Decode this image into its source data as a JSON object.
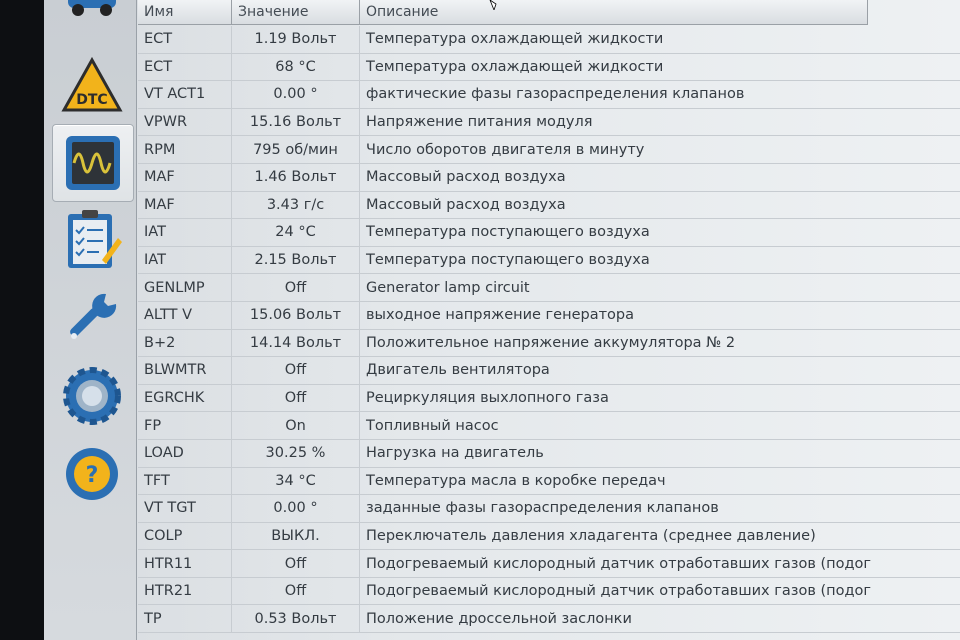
{
  "header": {
    "name": "Имя",
    "value": "Значение",
    "description": "Описание"
  },
  "sidebar": {
    "items": [
      {
        "name": "car-icon",
        "active": false
      },
      {
        "name": "dtc-icon",
        "label": "DTC",
        "active": false
      },
      {
        "name": "oscilloscope-icon",
        "active": true
      },
      {
        "name": "checklist-icon",
        "active": false
      },
      {
        "name": "wrench-icon",
        "active": false
      },
      {
        "name": "settings-gear-icon",
        "active": false
      },
      {
        "name": "steering-help-icon",
        "label": "?",
        "active": false
      }
    ]
  },
  "rows": [
    {
      "name": "ECT",
      "value": "1.19 Вольт",
      "desc": "Температура охлаждающей жидкости"
    },
    {
      "name": "ECT",
      "value": "68 °C",
      "desc": "Температура охлаждающей жидкости"
    },
    {
      "name": "VT ACT1",
      "value": "0.00 °",
      "desc": "фактические фазы газораспределения клапанов"
    },
    {
      "name": "VPWR",
      "value": "15.16 Вольт",
      "desc": "Напряжение питания модуля"
    },
    {
      "name": "RPM",
      "value": "795 об/мин",
      "desc": "Число оборотов двигателя в минуту"
    },
    {
      "name": "MAF",
      "value": "1.46 Вольт",
      "desc": "Массовый расход воздуха"
    },
    {
      "name": "MAF",
      "value": "3.43 г/с",
      "desc": "Массовый расход воздуха"
    },
    {
      "name": "IAT",
      "value": "24 °C",
      "desc": "Температура поступающего воздуха"
    },
    {
      "name": "IAT",
      "value": "2.15 Вольт",
      "desc": "Температура поступающего воздуха"
    },
    {
      "name": "GENLMP",
      "value": "Off",
      "desc": "Generator lamp circuit"
    },
    {
      "name": "ALTT V",
      "value": "15.06 Вольт",
      "desc": "выходное напряжение генератора"
    },
    {
      "name": "B+2",
      "value": "14.14 Вольт",
      "desc": "Положительное напряжение аккумулятора № 2"
    },
    {
      "name": "BLWMTR",
      "value": "Off",
      "desc": "Двигатель вентилятора"
    },
    {
      "name": "EGRCHK",
      "value": "Off",
      "desc": "Рециркуляция выхлопного газа"
    },
    {
      "name": "FP",
      "value": "On",
      "desc": "Топливный насос"
    },
    {
      "name": "LOAD",
      "value": "30.25 %",
      "desc": "Нагрузка на двигатель"
    },
    {
      "name": "TFT",
      "value": "34 °C",
      "desc": "Температура масла в коробке передач"
    },
    {
      "name": "VT TGT",
      "value": "0.00 °",
      "desc": "заданные фазы газораспределения клапанов"
    },
    {
      "name": "COLP",
      "value": "ВЫКЛ.",
      "desc": "Переключатель давления хладагента (среднее давление)"
    },
    {
      "name": "HTR11",
      "value": "Off",
      "desc": "Подогреваемый кислородный датчик отработавших газов (подог"
    },
    {
      "name": "HTR21",
      "value": "Off",
      "desc": "Подогреваемый кислородный датчик отработавших газов (подог"
    },
    {
      "name": "TP",
      "value": "0.53 Вольт",
      "desc": "Положение дроссельной заслонки"
    }
  ],
  "colors": {
    "dtc_yellow": "#f2b31b",
    "icon_blue": "#2b6fb3",
    "scope_wave": "#d9c23a"
  }
}
